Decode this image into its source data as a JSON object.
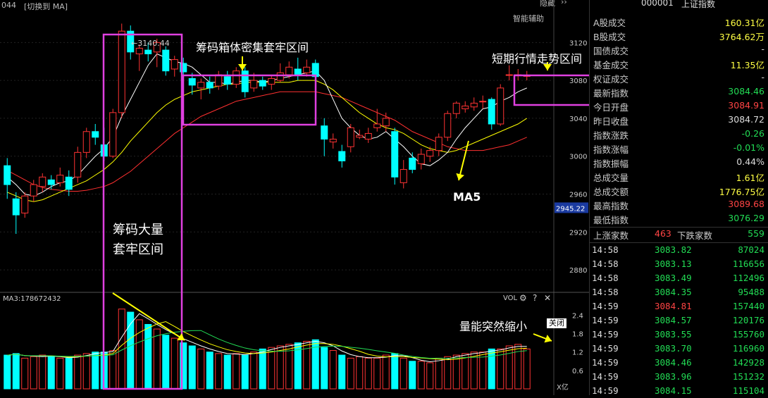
{
  "header": {
    "code_fragment": "044",
    "switch_label": "[切换到 MA]",
    "hide_label": "隐藏",
    "assist_label": "智能辅助",
    "stock_code": "000001",
    "stock_name": "上证指数"
  },
  "colors": {
    "up": "#ff3333",
    "down": "#00ffff",
    "ma5": "#ffffff",
    "ma10": "#ffff00",
    "ma20": "#ff3030",
    "annotation_box": "#e040e0",
    "arrow": "#ffff00"
  },
  "chart_data": {
    "type": "candlestick",
    "y_ticks": [
      "3120",
      "3080",
      "3040",
      "3000",
      "2960",
      "2920",
      "2880"
    ],
    "y_range": [
      2860,
      3150
    ],
    "current_price_label": "2945.22",
    "high_marker": "3140.44",
    "candles": [
      {
        "o": 2990,
        "c": 2970,
        "h": 2998,
        "l": 2955
      },
      {
        "o": 2955,
        "c": 2938,
        "h": 2962,
        "l": 2918
      },
      {
        "o": 2940,
        "c": 2958,
        "h": 2962,
        "l": 2935
      },
      {
        "o": 2958,
        "c": 2970,
        "h": 2975,
        "l": 2952
      },
      {
        "o": 2968,
        "c": 2978,
        "h": 2982,
        "l": 2962
      },
      {
        "o": 2975,
        "c": 2970,
        "h": 2980,
        "l": 2965
      },
      {
        "o": 2972,
        "c": 2980,
        "h": 2988,
        "l": 2968
      },
      {
        "o": 2978,
        "c": 2965,
        "h": 2985,
        "l": 2958
      },
      {
        "o": 2978,
        "c": 3004,
        "h": 3010,
        "l": 2972
      },
      {
        "o": 3004,
        "c": 3026,
        "h": 3030,
        "l": 2998
      },
      {
        "o": 3026,
        "c": 3020,
        "h": 3034,
        "l": 3012
      },
      {
        "o": 3012,
        "c": 3000,
        "h": 3030,
        "l": 2995
      },
      {
        "o": 3000,
        "c": 3046,
        "h": 3050,
        "l": 2998
      },
      {
        "o": 3046,
        "c": 3132,
        "h": 3140,
        "l": 3040
      },
      {
        "o": 3132,
        "c": 3110,
        "h": 3138,
        "l": 3102
      },
      {
        "o": 3108,
        "c": 3114,
        "h": 3118,
        "l": 3090
      },
      {
        "o": 3112,
        "c": 3108,
        "h": 3120,
        "l": 3100
      },
      {
        "o": 3110,
        "c": 3120,
        "h": 3124,
        "l": 3094
      },
      {
        "o": 3112,
        "c": 3090,
        "h": 3116,
        "l": 3085
      },
      {
        "o": 3092,
        "c": 3102,
        "h": 3106,
        "l": 3084
      },
      {
        "o": 3098,
        "c": 3089,
        "h": 3104,
        "l": 3082
      },
      {
        "o": 3082,
        "c": 3075,
        "h": 3088,
        "l": 3065
      },
      {
        "o": 3072,
        "c": 3078,
        "h": 3082,
        "l": 3060
      },
      {
        "o": 3078,
        "c": 3072,
        "h": 3084,
        "l": 3066
      },
      {
        "o": 3074,
        "c": 3086,
        "h": 3090,
        "l": 3070
      },
      {
        "o": 3084,
        "c": 3076,
        "h": 3090,
        "l": 3070
      },
      {
        "o": 3076,
        "c": 3090,
        "h": 3094,
        "l": 3072
      },
      {
        "o": 3090,
        "c": 3068,
        "h": 3094,
        "l": 3062
      },
      {
        "o": 3072,
        "c": 3080,
        "h": 3088,
        "l": 3068
      },
      {
        "o": 3080,
        "c": 3074,
        "h": 3084,
        "l": 3070
      },
      {
        "o": 3076,
        "c": 3082,
        "h": 3086,
        "l": 3070
      },
      {
        "o": 3080,
        "c": 3088,
        "h": 3098,
        "l": 3078
      },
      {
        "o": 3086,
        "c": 3094,
        "h": 3100,
        "l": 3082
      },
      {
        "o": 3092,
        "c": 3086,
        "h": 3104,
        "l": 3080
      },
      {
        "o": 3088,
        "c": 3094,
        "h": 3102,
        "l": 3084
      },
      {
        "o": 3098,
        "c": 3084,
        "h": 3102,
        "l": 3078
      },
      {
        "o": 3032,
        "c": 3018,
        "h": 3040,
        "l": 3000
      },
      {
        "o": 3015,
        "c": 3018,
        "h": 3024,
        "l": 3008
      },
      {
        "o": 3005,
        "c": 2995,
        "h": 3012,
        "l": 2988
      },
      {
        "o": 3010,
        "c": 3030,
        "h": 3034,
        "l": 3004
      },
      {
        "o": 3020,
        "c": 3022,
        "h": 3028,
        "l": 3018
      },
      {
        "o": 3018,
        "c": 3024,
        "h": 3030,
        "l": 3014
      },
      {
        "o": 3030,
        "c": 3034,
        "h": 3050,
        "l": 3026
      },
      {
        "o": 3032,
        "c": 3040,
        "h": 3046,
        "l": 3026
      },
      {
        "o": 3026,
        "c": 2978,
        "h": 3030,
        "l": 2970
      },
      {
        "o": 2972,
        "c": 2986,
        "h": 2996,
        "l": 2966
      },
      {
        "o": 2998,
        "c": 2986,
        "h": 3004,
        "l": 2982
      },
      {
        "o": 2992,
        "c": 3002,
        "h": 3008,
        "l": 2986
      },
      {
        "o": 3000,
        "c": 3006,
        "h": 3010,
        "l": 2994
      },
      {
        "o": 3006,
        "c": 3020,
        "h": 3024,
        "l": 3000
      },
      {
        "o": 3020,
        "c": 3045,
        "h": 3048,
        "l": 3016
      },
      {
        "o": 3045,
        "c": 3056,
        "h": 3058,
        "l": 3040
      },
      {
        "o": 3050,
        "c": 3053,
        "h": 3058,
        "l": 3046
      },
      {
        "o": 3052,
        "c": 3056,
        "h": 3062,
        "l": 3048
      },
      {
        "o": 3058,
        "c": 3058,
        "h": 3064,
        "l": 3050
      },
      {
        "o": 3060,
        "c": 3034,
        "h": 3062,
        "l": 3028
      },
      {
        "o": 3034,
        "c": 3072,
        "h": 3076,
        "l": 3032
      },
      {
        "o": 3086,
        "c": 3086,
        "h": 3096,
        "l": 3080
      },
      {
        "o": 3086,
        "c": 3086,
        "h": 3092,
        "l": 3080
      },
      {
        "o": 3085,
        "c": 3085,
        "h": 3090,
        "l": 3080
      }
    ],
    "ma5": [
      2978,
      2970,
      2960,
      2958,
      2962,
      2968,
      2972,
      2974,
      2980,
      2990,
      3000,
      3008,
      3020,
      3042,
      3060,
      3078,
      3096,
      3108,
      3104,
      3100,
      3098,
      3094,
      3086,
      3078,
      3078,
      3076,
      3078,
      3080,
      3080,
      3078,
      3080,
      3082,
      3084,
      3086,
      3088,
      3090,
      3080,
      3060,
      3040,
      3030,
      3022,
      3018,
      3020,
      3026,
      3018,
      3010,
      3000,
      2992,
      2990,
      2996,
      3004,
      3018,
      3030,
      3040,
      3050,
      3052,
      3058,
      3062,
      3068,
      3072
    ],
    "ma10": [
      2962,
      2958,
      2954,
      2952,
      2954,
      2958,
      2962,
      2966,
      2970,
      2974,
      2980,
      2986,
      2994,
      3004,
      3016,
      3026,
      3036,
      3046,
      3054,
      3060,
      3064,
      3068,
      3070,
      3072,
      3074,
      3076,
      3076,
      3078,
      3078,
      3078,
      3078,
      3078,
      3078,
      3080,
      3080,
      3080,
      3076,
      3070,
      3062,
      3054,
      3046,
      3040,
      3034,
      3030,
      3028,
      3024,
      3018,
      3012,
      3008,
      3006,
      3004,
      3006,
      3010,
      3014,
      3018,
      3022,
      3026,
      3030,
      3034,
      3040
    ],
    "ma20": [
      2985,
      2980,
      2975,
      2970,
      2967,
      2965,
      2964,
      2963,
      2963,
      2964,
      2966,
      2968,
      2972,
      2978,
      2984,
      2992,
      3000,
      3008,
      3016,
      3024,
      3030,
      3036,
      3042,
      3046,
      3050,
      3054,
      3058,
      3060,
      3062,
      3064,
      3066,
      3068,
      3068,
      3068,
      3068,
      3068,
      3066,
      3064,
      3062,
      3058,
      3054,
      3050,
      3046,
      3042,
      3038,
      3032,
      3026,
      3022,
      3018,
      3014,
      3010,
      3008,
      3006,
      3006,
      3006,
      3008,
      3010,
      3012,
      3016,
      3020
    ],
    "volume_label": "MA3:178672432",
    "volume_ticks": [
      "2.4",
      "1.8",
      "1.2",
      "0.6"
    ],
    "volume_range": [
      0,
      2.8
    ],
    "volume_unit": "X亿",
    "volumes": [
      1.1,
      1.15,
      1.0,
      1.05,
      1.1,
      1.05,
      1.0,
      1.0,
      1.1,
      1.15,
      1.2,
      1.2,
      1.25,
      2.6,
      2.5,
      2.25,
      2.1,
      1.95,
      1.75,
      1.65,
      1.5,
      1.4,
      1.3,
      1.2,
      1.15,
      1.1,
      1.15,
      1.1,
      1.2,
      1.3,
      1.35,
      1.4,
      1.45,
      1.5,
      1.55,
      1.6,
      1.35,
      1.25,
      1.1,
      1.0,
      1.05,
      1.0,
      1.0,
      1.1,
      1.15,
      1.0,
      0.9,
      0.9,
      0.85,
      1.0,
      1.05,
      1.1,
      1.15,
      1.2,
      1.2,
      1.3,
      1.3,
      1.4,
      1.45,
      1.3
    ]
  },
  "annotations": {
    "box1_text": "筹码箱体密集套牢区间",
    "box2_line1": "筹码大量",
    "box2_line2": "套牢区间",
    "box3_text": "短期行情走势区间",
    "ma5_label": "MA5",
    "volume_text": "量能突然缩小",
    "close_btn": "关闭"
  },
  "vol_header": {
    "vol_label": "VOL"
  },
  "side_stats": [
    {
      "label": "A股成交",
      "value": "160.31亿",
      "color": "yellow"
    },
    {
      "label": "B股成交",
      "value": "3764.62万",
      "color": "yellow"
    },
    {
      "label": "国债成交",
      "value": "-",
      "color": "white"
    },
    {
      "label": "基金成交",
      "value": "11.35亿",
      "color": "yellow"
    },
    {
      "label": "权证成交",
      "value": "-",
      "color": "white"
    },
    {
      "label": "最新指数",
      "value": "3084.46",
      "color": "green"
    },
    {
      "label": "今日开盘",
      "value": "3084.91",
      "color": "red"
    },
    {
      "label": "昨日收盘",
      "value": "3084.72",
      "color": "white"
    },
    {
      "label": "指数涨跌",
      "value": "-0.26",
      "color": "green"
    },
    {
      "label": "指数涨幅",
      "value": "-0.01%",
      "color": "green"
    },
    {
      "label": "指数振幅",
      "value": "0.44%",
      "color": "white"
    },
    {
      "label": "总成交量",
      "value": "1.61亿",
      "color": "yellow"
    },
    {
      "label": "总成交额",
      "value": "1776.75亿",
      "color": "yellow"
    },
    {
      "label": "最高指数",
      "value": "3089.68",
      "color": "red"
    },
    {
      "label": "最低指数",
      "value": "3076.29",
      "color": "green"
    }
  ],
  "updown": {
    "up_label": "上涨家数",
    "up_value": "463",
    "down_label": "下跌家数",
    "down_value": "559"
  },
  "trades": [
    {
      "time": "14:58",
      "price": "3083.82",
      "vol": "87024",
      "color": "green"
    },
    {
      "time": "14:58",
      "price": "3083.13",
      "vol": "116656",
      "color": "green"
    },
    {
      "time": "14:58",
      "price": "3083.49",
      "vol": "112496",
      "color": "green"
    },
    {
      "time": "14:58",
      "price": "3084.35",
      "vol": "95488",
      "color": "green"
    },
    {
      "time": "14:59",
      "price": "3084.81",
      "vol": "157440",
      "color": "red"
    },
    {
      "time": "14:59",
      "price": "3084.57",
      "vol": "120176",
      "color": "green"
    },
    {
      "time": "14:59",
      "price": "3083.55",
      "vol": "155760",
      "color": "green"
    },
    {
      "time": "14:59",
      "price": "3083.70",
      "vol": "116960",
      "color": "green"
    },
    {
      "time": "14:59",
      "price": "3084.46",
      "vol": "142928",
      "color": "green"
    },
    {
      "time": "14:59",
      "price": "3083.96",
      "vol": "151232",
      "color": "green"
    },
    {
      "time": "14:59",
      "price": "3084.15",
      "vol": "115104",
      "color": "green"
    }
  ]
}
